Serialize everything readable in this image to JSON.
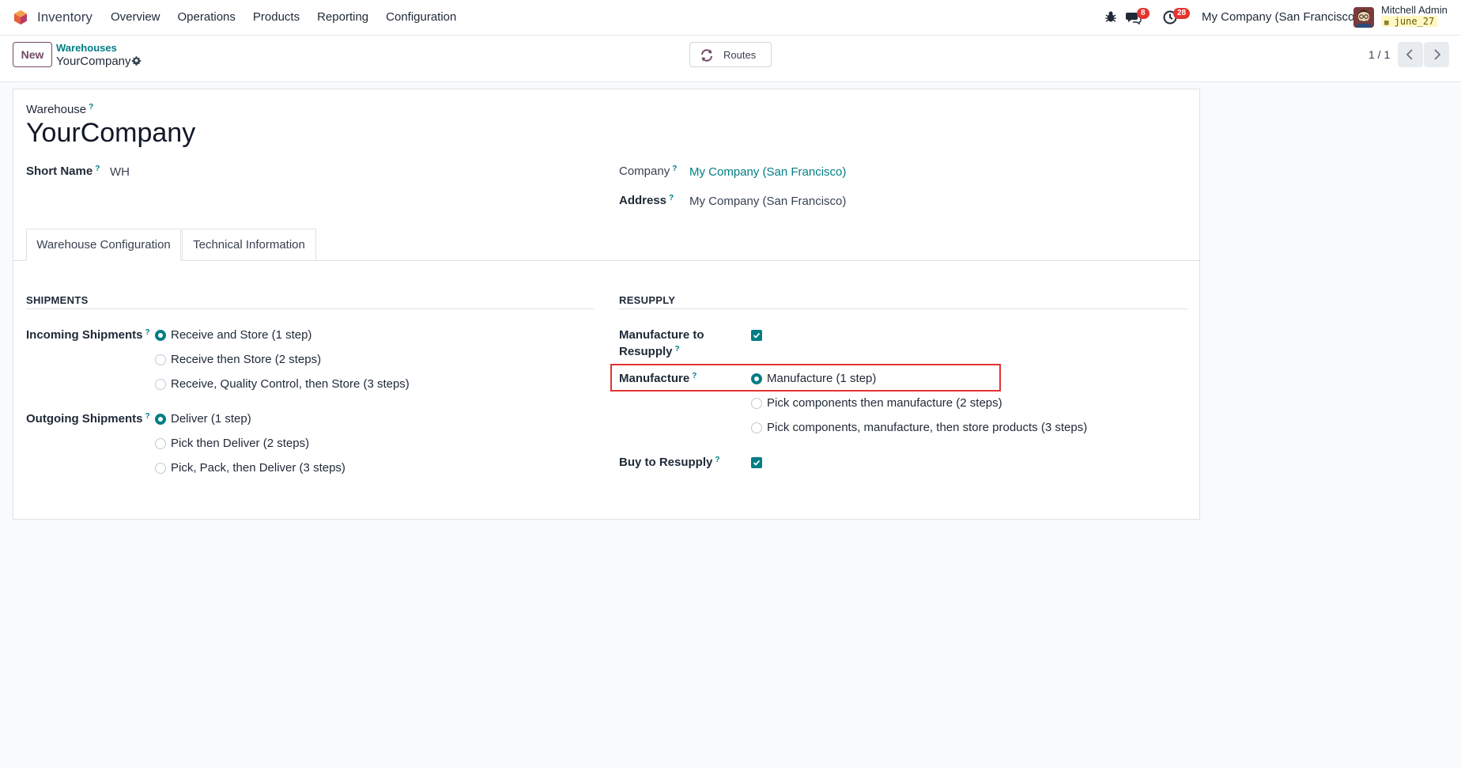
{
  "navbar": {
    "app_name": "Inventory",
    "menu": [
      "Overview",
      "Operations",
      "Products",
      "Reporting",
      "Configuration"
    ],
    "messages_count": "8",
    "activities_count": "28",
    "company": "My Company (San Francisco)",
    "user_name": "Mitchell Admin",
    "database": "june_27",
    "brand_color": "#714b67"
  },
  "control_panel": {
    "new_label": "New",
    "breadcrumb": "Warehouses",
    "record_name": "YourCompany",
    "routes_label": "Routes",
    "pager": "1 / 1"
  },
  "form": {
    "name_label": "Warehouse",
    "name_help": "?",
    "name_value": "YourCompany",
    "short_name_label": "Short Name",
    "short_name_value": "WH",
    "company_label": "Company",
    "company_value": "My Company (San Francisco)",
    "address_label": "Address",
    "address_value": "My Company (San Francisco)",
    "tabs": [
      "Warehouse Configuration",
      "Technical Information"
    ],
    "shipments": {
      "title": "SHIPMENTS",
      "incoming_label": "Incoming Shipments",
      "incoming_options": [
        "Receive and Store (1 step)",
        "Receive then Store (2 steps)",
        "Receive, Quality Control, then Store (3 steps)"
      ],
      "incoming_selected": 0,
      "outgoing_label": "Outgoing Shipments",
      "outgoing_options": [
        "Deliver (1 step)",
        "Pick then Deliver (2 steps)",
        "Pick, Pack, then Deliver (3 steps)"
      ],
      "outgoing_selected": 0
    },
    "resupply": {
      "title": "RESUPPLY",
      "manufacture_to_resupply_label_1": "Manufacture to",
      "manufacture_to_resupply_label_2": "Resupply",
      "manufacture_to_resupply_checked": true,
      "manufacture_label": "Manufacture",
      "manufacture_options": [
        "Manufacture (1 step)",
        "Pick components then manufacture (2 steps)",
        "Pick components, manufacture, then store products (3 steps)"
      ],
      "manufacture_selected": 0,
      "buy_label": "Buy to Resupply",
      "buy_checked": true
    }
  },
  "colors": {
    "accent": "#017e84",
    "highlight": "#e3342f"
  }
}
